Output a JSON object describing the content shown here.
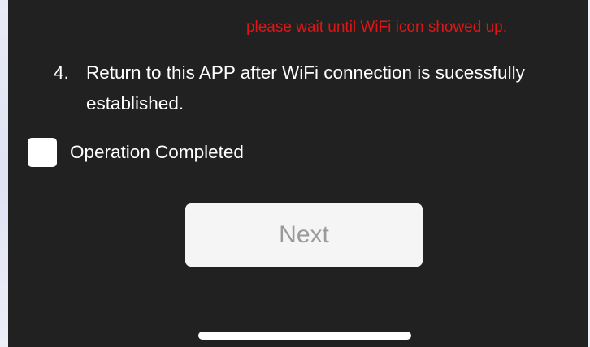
{
  "warning_text": "please wait until WiFi icon showed up.",
  "step": {
    "number": "4.",
    "text": "Return to this APP after WiFi connection is sucessfully established."
  },
  "confirm": {
    "label": "Operation Completed",
    "checked": false
  },
  "next_button": {
    "label": "Next"
  },
  "colors": {
    "background": "#212121",
    "warning": "#e01515",
    "text": "#ffffff",
    "button_bg": "#f5f5f5",
    "button_text_disabled": "#9a9a9a"
  }
}
